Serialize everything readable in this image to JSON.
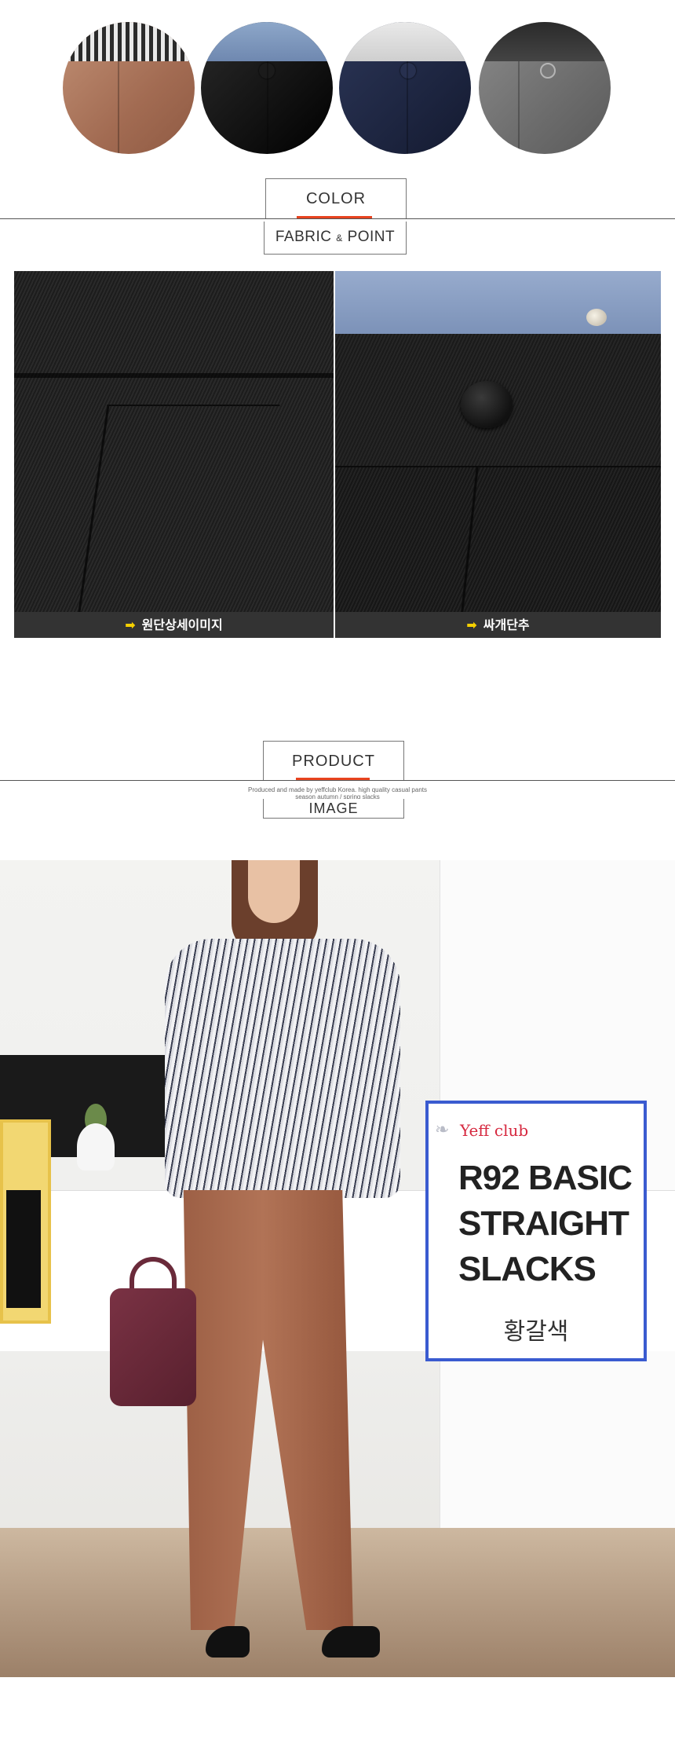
{
  "sections": {
    "color": {
      "title": "COLOR"
    },
    "fabric_point": {
      "title_part1": "FABRIC",
      "title_amp": "&",
      "title_part2": "POINT"
    },
    "product_image": {
      "title_top": "PRODUCT",
      "title_bottom": "IMAGE",
      "subtitle_line1": "Produced and made by yeffclub Korea. high quality casual pants",
      "subtitle_line2": "season autumn / spring slacks"
    }
  },
  "swatches": [
    {
      "name": "camel",
      "color": "#a86f55"
    },
    {
      "name": "black",
      "color": "#151515"
    },
    {
      "name": "navy",
      "color": "#1f2844"
    },
    {
      "name": "gray",
      "color": "#6e6e6e"
    }
  ],
  "fabric_captions": [
    {
      "icon": "arrow-right-icon",
      "label": "원단상세이미지"
    },
    {
      "icon": "arrow-right-icon",
      "label": "싸개단추"
    }
  ],
  "product_card": {
    "brand": "Yeff club",
    "name_lines": [
      "R92 BASIC",
      "STRAIGHT",
      "SLACKS"
    ],
    "color_name": "황갈색",
    "border_color": "#3a5bd0",
    "brand_color": "#d6283f"
  },
  "colors": {
    "accent": "#e8431f",
    "caption_bg": "#333333",
    "arrow": "#f5d000"
  }
}
